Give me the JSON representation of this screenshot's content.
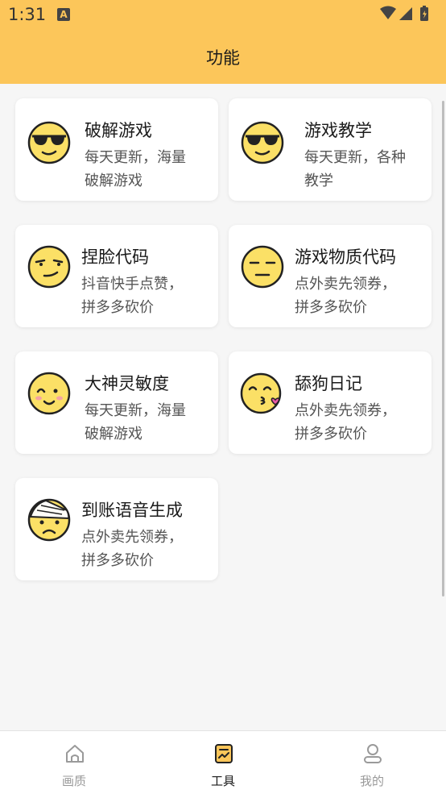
{
  "status_bar": {
    "time": "1:31",
    "notification_letter": "A"
  },
  "header": {
    "title": "功能"
  },
  "cards": [
    {
      "title": "破解游戏",
      "desc_line1": "每天更新，海量",
      "desc_line2": "破解游戏",
      "icon": "sunglasses-face-icon"
    },
    {
      "title": "游戏教学",
      "desc_line1": "每天更新，各种",
      "desc_line2": "教学",
      "icon": "sunglasses-face-icon"
    },
    {
      "title": "捏脸代码",
      "desc_line1": "抖音快手点赞，",
      "desc_line2": "拼多多砍价",
      "icon": "smirk-face-icon"
    },
    {
      "title": "游戏物质代码",
      "desc_line1": "点外卖先领券，",
      "desc_line2": "拼多多砍价",
      "icon": "expressionless-face-icon"
    },
    {
      "title": "大神灵敏度",
      "desc_line1": "每天更新，海量",
      "desc_line2": "破解游戏",
      "icon": "happy-face-icon"
    },
    {
      "title": "舔狗日记",
      "desc_line1": "点外卖先领券，",
      "desc_line2": "拼多多砍价",
      "icon": "kissing-face-icon"
    },
    {
      "title": "到账语音生成",
      "desc_line1": "点外卖先领券，",
      "desc_line2": "拼多多砍价",
      "icon": "bandaged-face-icon"
    }
  ],
  "bottom_nav": [
    {
      "label": "画质",
      "icon": "home-icon",
      "active": false
    },
    {
      "label": "工具",
      "icon": "tool-icon",
      "active": true
    },
    {
      "label": "我的",
      "icon": "user-icon",
      "active": false
    }
  ],
  "colors": {
    "accent": "#fcc65a",
    "face_yellow": "#fbe066",
    "background": "#f6f6f6"
  }
}
